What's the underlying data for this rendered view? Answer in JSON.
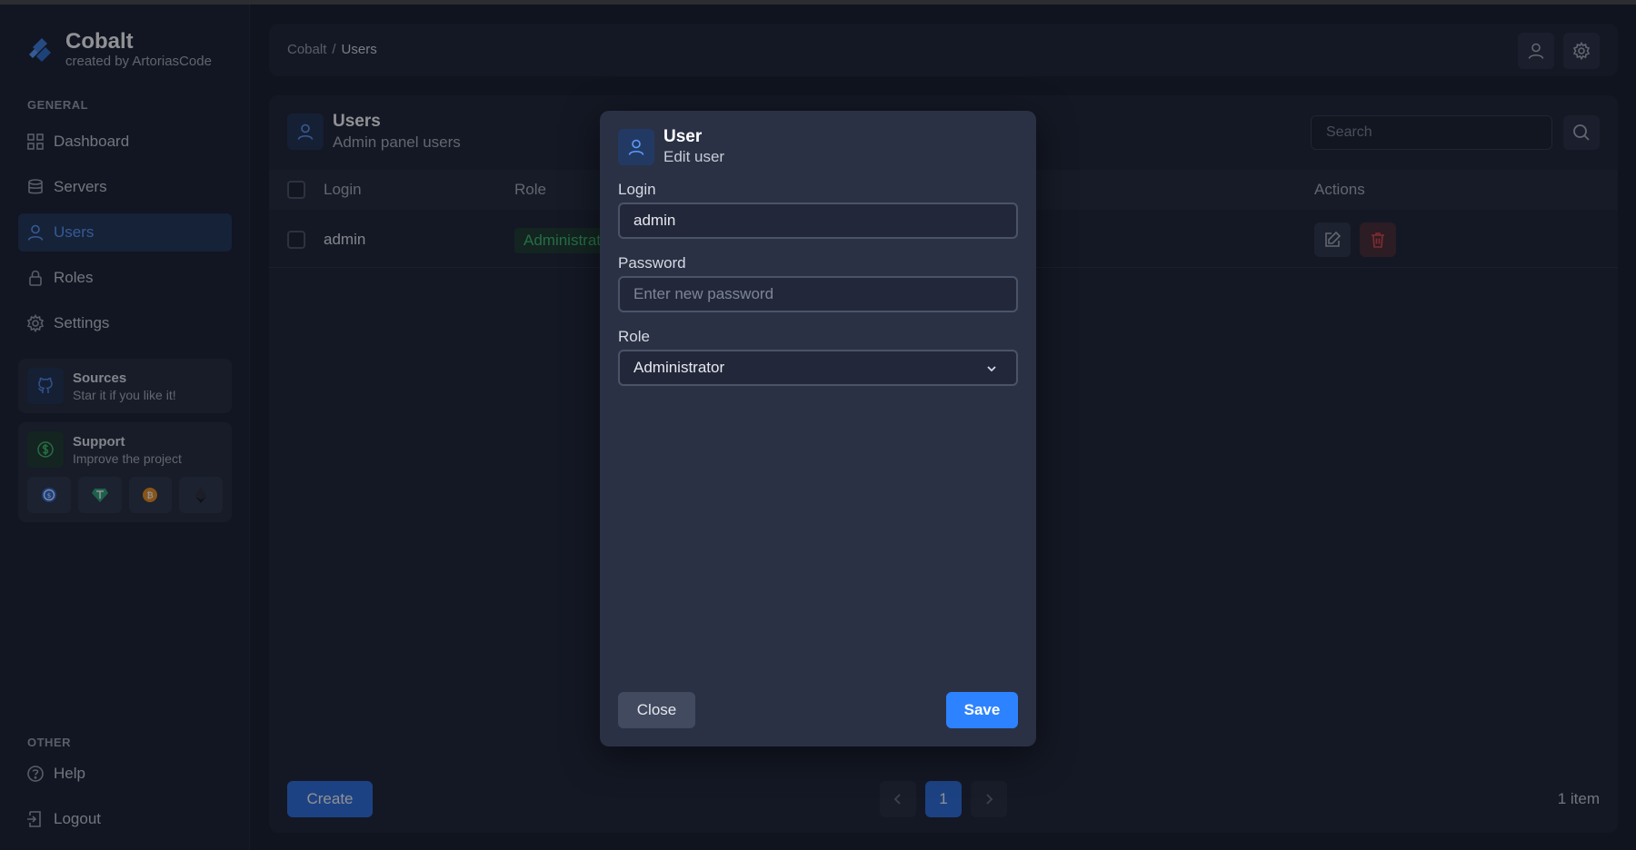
{
  "brand": {
    "name": "Cobalt",
    "subtitle": "created by ArtoriasCode"
  },
  "sidebar": {
    "general_label": "GENERAL",
    "items": [
      {
        "label": "Dashboard",
        "icon": "dashboard-icon"
      },
      {
        "label": "Servers",
        "icon": "database-icon"
      },
      {
        "label": "Users",
        "icon": "user-icon",
        "active": true
      },
      {
        "label": "Roles",
        "icon": "lock-icon"
      },
      {
        "label": "Settings",
        "icon": "gear-icon"
      }
    ],
    "sources_card": {
      "title": "Sources",
      "subtitle": "Star it if you like it!"
    },
    "support_card": {
      "title": "Support",
      "subtitle": "Improve the project"
    },
    "other_label": "OTHER",
    "other_items": [
      {
        "label": "Help",
        "icon": "help-icon"
      },
      {
        "label": "Logout",
        "icon": "logout-icon"
      }
    ]
  },
  "header": {
    "breadcrumb": [
      "Cobalt",
      "Users"
    ]
  },
  "panel": {
    "title": "Users",
    "subtitle": "Admin panel users",
    "search_placeholder": "Search",
    "columns": {
      "login": "Login",
      "role": "Role",
      "actions": "Actions"
    },
    "rows": [
      {
        "login": "admin",
        "role": "Administrator"
      }
    ],
    "create_label": "Create",
    "current_page": "1",
    "item_count": "1 item"
  },
  "modal": {
    "title": "User",
    "subtitle": "Edit user",
    "login_label": "Login",
    "login_value": "admin",
    "password_label": "Password",
    "password_placeholder": "Enter new password",
    "role_label": "Role",
    "role_value": "Administrator",
    "close_label": "Close",
    "save_label": "Save"
  },
  "colors": {
    "accent": "#2d83ff",
    "active_nav": "#5b9bff",
    "role_badge": "#3fbf6b",
    "danger": "#e04848"
  }
}
